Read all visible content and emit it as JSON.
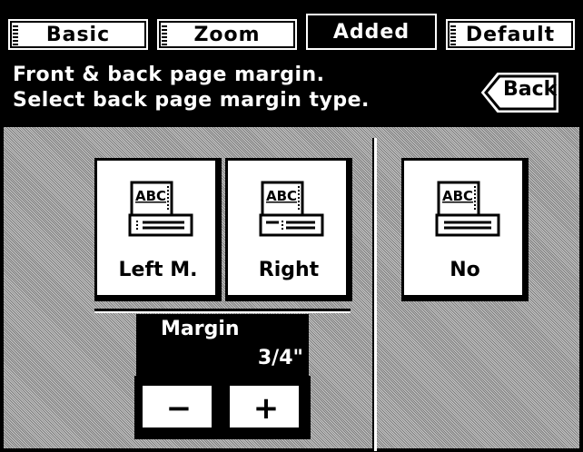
{
  "tabs": [
    {
      "label": "Basic",
      "active": false
    },
    {
      "label": "Zoom",
      "active": false
    },
    {
      "label": "Added",
      "active": true
    },
    {
      "label": "Default",
      "active": false
    }
  ],
  "header": {
    "line1": "Front & back page margin.",
    "line2": "Select back page margin type.",
    "back_label": "Back"
  },
  "options": [
    {
      "label": "Left M.",
      "icon": "page-margin-left-icon",
      "icon_text": "ABC"
    },
    {
      "label": "Right",
      "icon": "page-margin-right-icon",
      "icon_text": "ABC"
    },
    {
      "label": "No",
      "icon": "page-no-margin-icon",
      "icon_text": "ABC"
    }
  ],
  "margin": {
    "title": "Margin",
    "value": "3/4\"",
    "minus_label": "−",
    "plus_label": "+"
  }
}
